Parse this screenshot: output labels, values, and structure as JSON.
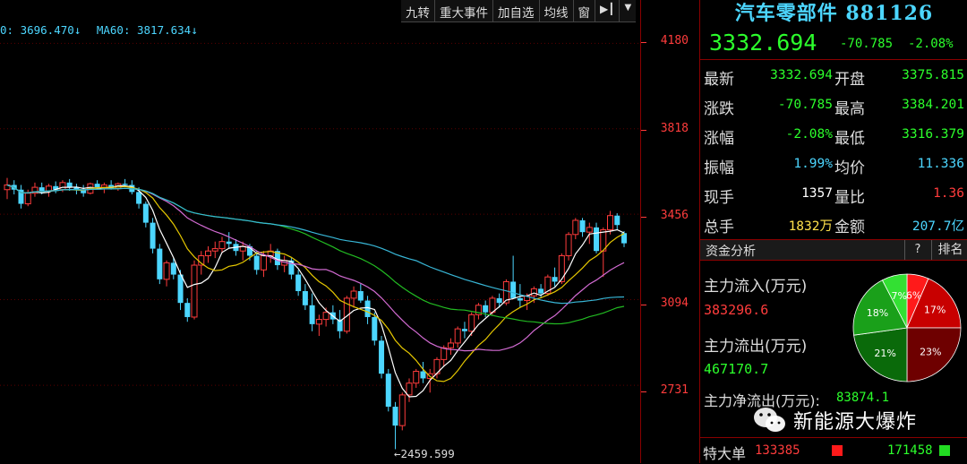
{
  "toolbar": [
    "九转",
    "重大事件",
    "加自选",
    "均线",
    "窗"
  ],
  "ma_legend": {
    "ma1": "0: 3696.470↓",
    "ma60": "MA60: 3817.634↓"
  },
  "y_ticks": [
    "4180",
    "3818",
    "3456",
    "3094",
    "2731"
  ],
  "low_label": "←2459.599",
  "chart_data": {
    "type": "candlestick",
    "y_ticks": [
      4180,
      3818,
      3456,
      3094,
      2731
    ],
    "ylim": [
      2420,
      4250
    ],
    "low_marker": 2459.599,
    "candles": [
      [
        3560,
        3610,
        3520,
        3580
      ],
      [
        3580,
        3600,
        3540,
        3560
      ],
      [
        3560,
        3580,
        3480,
        3500
      ],
      [
        3500,
        3560,
        3490,
        3545
      ],
      [
        3545,
        3590,
        3530,
        3570
      ],
      [
        3570,
        3590,
        3540,
        3555
      ],
      [
        3555,
        3585,
        3530,
        3575
      ],
      [
        3575,
        3595,
        3545,
        3560
      ],
      [
        3560,
        3600,
        3550,
        3590
      ],
      [
        3590,
        3605,
        3555,
        3570
      ],
      [
        3570,
        3585,
        3540,
        3560
      ],
      [
        3560,
        3580,
        3530,
        3545
      ],
      [
        3545,
        3590,
        3540,
        3585
      ],
      [
        3585,
        3600,
        3560,
        3570
      ],
      [
        3570,
        3590,
        3545,
        3580
      ],
      [
        3580,
        3600,
        3560,
        3565
      ],
      [
        3565,
        3590,
        3555,
        3585
      ],
      [
        3585,
        3605,
        3570,
        3580
      ],
      [
        3580,
        3600,
        3540,
        3550
      ],
      [
        3550,
        3570,
        3480,
        3500
      ],
      [
        3500,
        3510,
        3400,
        3420
      ],
      [
        3420,
        3440,
        3290,
        3310
      ],
      [
        3310,
        3330,
        3160,
        3180
      ],
      [
        3180,
        3260,
        3150,
        3250
      ],
      [
        3250,
        3270,
        3180,
        3200
      ],
      [
        3200,
        3220,
        3050,
        3080
      ],
      [
        3080,
        3100,
        3000,
        3020
      ],
      [
        3020,
        3260,
        3010,
        3240
      ],
      [
        3240,
        3300,
        3200,
        3280
      ],
      [
        3280,
        3320,
        3250,
        3300
      ],
      [
        3300,
        3340,
        3270,
        3310
      ],
      [
        3310,
        3360,
        3290,
        3340
      ],
      [
        3340,
        3380,
        3310,
        3330
      ],
      [
        3330,
        3350,
        3280,
        3300
      ],
      [
        3300,
        3340,
        3260,
        3320
      ],
      [
        3320,
        3330,
        3260,
        3280
      ],
      [
        3280,
        3300,
        3200,
        3220
      ],
      [
        3220,
        3300,
        3190,
        3280
      ],
      [
        3280,
        3330,
        3250,
        3300
      ],
      [
        3300,
        3310,
        3220,
        3240
      ],
      [
        3240,
        3280,
        3210,
        3260
      ],
      [
        3260,
        3270,
        3180,
        3200
      ],
      [
        3200,
        3220,
        3110,
        3130
      ],
      [
        3130,
        3160,
        3050,
        3070
      ],
      [
        3070,
        3120,
        2960,
        2990
      ],
      [
        2990,
        3030,
        2940,
        3010
      ],
      [
        3010,
        3060,
        2980,
        3040
      ],
      [
        3040,
        3070,
        2990,
        3010
      ],
      [
        3010,
        3050,
        2930,
        2960
      ],
      [
        2960,
        3110,
        2950,
        3100
      ],
      [
        3100,
        3150,
        3060,
        3130
      ],
      [
        3130,
        3160,
        3080,
        3090
      ],
      [
        3090,
        3110,
        2990,
        3020
      ],
      [
        3020,
        3040,
        2900,
        2920
      ],
      [
        2920,
        2940,
        2760,
        2780
      ],
      [
        2780,
        2800,
        2620,
        2640
      ],
      [
        2640,
        2660,
        2460,
        2560
      ],
      [
        2560,
        2700,
        2540,
        2690
      ],
      [
        2690,
        2760,
        2660,
        2740
      ],
      [
        2740,
        2800,
        2720,
        2790
      ],
      [
        2790,
        2830,
        2740,
        2760
      ],
      [
        2760,
        2800,
        2700,
        2780
      ],
      [
        2780,
        2850,
        2760,
        2840
      ],
      [
        2840,
        2900,
        2810,
        2890
      ],
      [
        2890,
        2930,
        2860,
        2910
      ],
      [
        2910,
        2980,
        2890,
        2970
      ],
      [
        2970,
        3000,
        2930,
        2960
      ],
      [
        2960,
        3040,
        2940,
        3030
      ],
      [
        3030,
        3080,
        3010,
        3070
      ],
      [
        3070,
        3090,
        3020,
        3040
      ],
      [
        3040,
        3110,
        3030,
        3100
      ],
      [
        3100,
        3120,
        3060,
        3080
      ],
      [
        3080,
        3180,
        3070,
        3170
      ],
      [
        3170,
        3280,
        3150,
        3100
      ],
      [
        3100,
        3160,
        3060,
        3090
      ],
      [
        3090,
        3120,
        3050,
        3110
      ],
      [
        3110,
        3150,
        3080,
        3140
      ],
      [
        3140,
        3160,
        3100,
        3120
      ],
      [
        3120,
        3200,
        3110,
        3190
      ],
      [
        3190,
        3230,
        3150,
        3170
      ],
      [
        3170,
        3290,
        3160,
        3280
      ],
      [
        3280,
        3380,
        3260,
        3370
      ],
      [
        3370,
        3440,
        3350,
        3430
      ],
      [
        3430,
        3440,
        3360,
        3380
      ],
      [
        3380,
        3420,
        3330,
        3400
      ],
      [
        3400,
        3420,
        3290,
        3300
      ],
      [
        3300,
        3400,
        3190,
        3390
      ],
      [
        3390,
        3470,
        3370,
        3450
      ],
      [
        3450,
        3460,
        3390,
        3410
      ],
      [
        3375.815,
        3384.201,
        3316.379,
        3332.694
      ]
    ]
  },
  "panel": {
    "title": "汽车零部件 881126",
    "price": "3332.694",
    "change": "-70.785",
    "change_pct": "-2.08%",
    "quote_rows": [
      {
        "l1": "最新",
        "v1": "3332.694",
        "c1": "g",
        "l2": "开盘",
        "v2": "3375.815",
        "c2": "g"
      },
      {
        "l1": "涨跌",
        "v1": "-70.785",
        "c1": "g",
        "l2": "最高",
        "v2": "3384.201",
        "c2": "g"
      },
      {
        "l1": "涨幅",
        "v1": "-2.08%",
        "c1": "g",
        "l2": "最低",
        "v2": "3316.379",
        "c2": "g"
      },
      {
        "l1": "振幅",
        "v1": "1.99%",
        "c1": "c",
        "l2": "均价",
        "v2": "11.336",
        "c2": "c"
      },
      {
        "l1": "现手",
        "v1": "1357",
        "c1": "w",
        "l2": "量比",
        "v2": "1.36",
        "c2": "r"
      },
      {
        "l1": "总手",
        "v1": "1832万",
        "c1": "y",
        "l2": "金额",
        "v2": "207.7亿",
        "c2": "c"
      }
    ],
    "fund_section": {
      "title": "资金分析",
      "help": "?",
      "rank": "排名",
      "inflow_label": "主力流入(万元)",
      "inflow_value": "383296.6",
      "outflow_label": "主力流出(万元)",
      "outflow_value": "467170.7",
      "net_label": "主力净流出(万元):",
      "net_value": "83874.1",
      "pie": [
        {
          "label": "6%",
          "value": 6,
          "color": "#ff1a1a"
        },
        {
          "label": "17%",
          "value": 17,
          "color": "#c80000"
        },
        {
          "label": "23%",
          "value": 23,
          "color": "#6e0000"
        },
        {
          "label": "21%",
          "value": 21,
          "color": "#0a6a0a"
        },
        {
          "label": "18%",
          "value": 18,
          "color": "#1aa01a"
        },
        {
          "label": "7%",
          "value": 7,
          "color": "#33e033"
        }
      ]
    },
    "bottom": {
      "label": "特大单",
      "buy": "133385",
      "sell": "171458"
    }
  },
  "watermark": "新能源大爆炸",
  "colors": {
    "up": "#ff3c3c",
    "down": "#4cd6ff",
    "ma_white": "#ffffff",
    "ma_yellow": "#e6c800",
    "ma_pink": "#d36bd3",
    "ma_green": "#22bb22",
    "ma_cyan": "#38b6d6"
  }
}
